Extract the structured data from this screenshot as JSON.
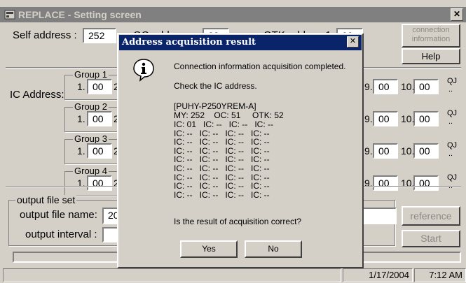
{
  "window": {
    "title": "REPLACE - Setting screen",
    "close_glyph": "✕"
  },
  "top": {
    "self_address_label": "Self address :",
    "self_address_value": "252",
    "oc_label": "OC address:",
    "oc_value": "00",
    "otk_label": "OTK address1:",
    "otk_value": "00",
    "connection_info_label": "connection information",
    "help_label": "Help"
  },
  "ic_address": {
    "label": "IC Address:",
    "groups": [
      {
        "label": "Group 1",
        "left_index": "1.",
        "left_value": "00",
        "left_next": "2",
        "right_index_a": "9.",
        "right_value_a": "00",
        "right_index_b": "10.",
        "right_value_b": "00",
        "qj": "QJ",
        "qj2": ".."
      },
      {
        "label": "Group 2",
        "left_index": "1.",
        "left_value": "00",
        "left_next": "2",
        "right_index_a": "9.",
        "right_value_a": "00",
        "right_index_b": "10.",
        "right_value_b": "00",
        "qj": "QJ",
        "qj2": ".."
      },
      {
        "label": "Group 3",
        "left_index": "1.",
        "left_value": "00",
        "left_next": "2",
        "right_index_a": "9.",
        "right_value_a": "00",
        "right_index_b": "10.",
        "right_value_b": "00",
        "qj": "QJ",
        "qj2": ".."
      },
      {
        "label": "Group 4",
        "left_index": "1.",
        "left_value": "00",
        "left_next": "2",
        "right_index_a": "9.",
        "right_value_a": "00",
        "right_index_b": "10.",
        "right_value_b": "00",
        "qj": "QJ",
        "qj2": ".."
      }
    ]
  },
  "output": {
    "group_label": "output file set",
    "file_name_label": "output file name:",
    "file_name_value": "200",
    "interval_label": "output interval :",
    "interval_value": "",
    "reference_label": "reference",
    "start_label": "Start"
  },
  "statusbar": {
    "date": "1/17/2004",
    "time": "7:12 AM"
  },
  "dialog": {
    "title": "Address acquisition result",
    "close_glyph": "✕",
    "icon": "info-icon",
    "message1": "Connection information acquisition completed.",
    "message2": "Check the IC address.",
    "model": "[PUHY-P250YREM-A]",
    "summary": "MY: 252    OC: 51     OTK: 52",
    "ic_lines": [
      "IC: 01   IC: --   IC: --   IC: --",
      "IC: --   IC: --   IC: --   IC: --",
      "IC: --   IC: --   IC: --   IC: --",
      "IC: --   IC: --   IC: --   IC: --",
      "IC: --   IC: --   IC: --   IC: --",
      "IC: --   IC: --   IC: --   IC: --",
      "IC: --   IC: --   IC: --   IC: --",
      "IC: --   IC: --   IC: --   IC: --",
      "IC: --   IC: --   IC: --   IC: --"
    ],
    "question": "Is the result of acquisition correct?",
    "yes_label": "Yes",
    "no_label": "No"
  }
}
